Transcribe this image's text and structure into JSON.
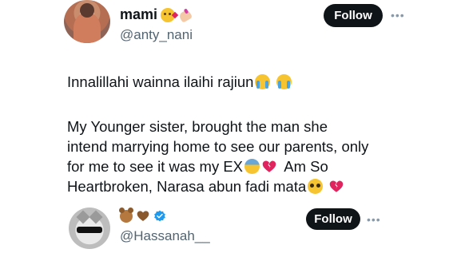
{
  "tweet": {
    "author": {
      "display_name": "mami",
      "name_emojis": [
        "kissing-heart-emoji",
        "nail-polish-emoji"
      ],
      "handle": "@anty_nani"
    },
    "follow_label": "Follow",
    "more_icon": "more-horizontal-icon",
    "text_line1": "Innalillahi wainna ilaihi rajiun",
    "paragraph2_part1": "My Younger sister, brought the man she\nintend marrying home to see our parents, only\nfor me to see it was my EX",
    "paragraph2_part2": "  Am So\nHeartbroken, Narasa abun fadi mata"
  },
  "reply": {
    "author": {
      "name_emojis": [
        "bear-emoji",
        "brown-heart-emoji"
      ],
      "verified_icon": "verified-badge-icon",
      "handle": "@Hassanah__"
    },
    "follow_label": "Follow",
    "more_icon": "more-horizontal-icon"
  },
  "colors": {
    "text_primary": "#0f1419",
    "text_secondary": "#536471",
    "follow_button_bg": "#0f1419",
    "verified_blue": "#1d9bf0",
    "broken_heart_red": "#e0245e"
  }
}
